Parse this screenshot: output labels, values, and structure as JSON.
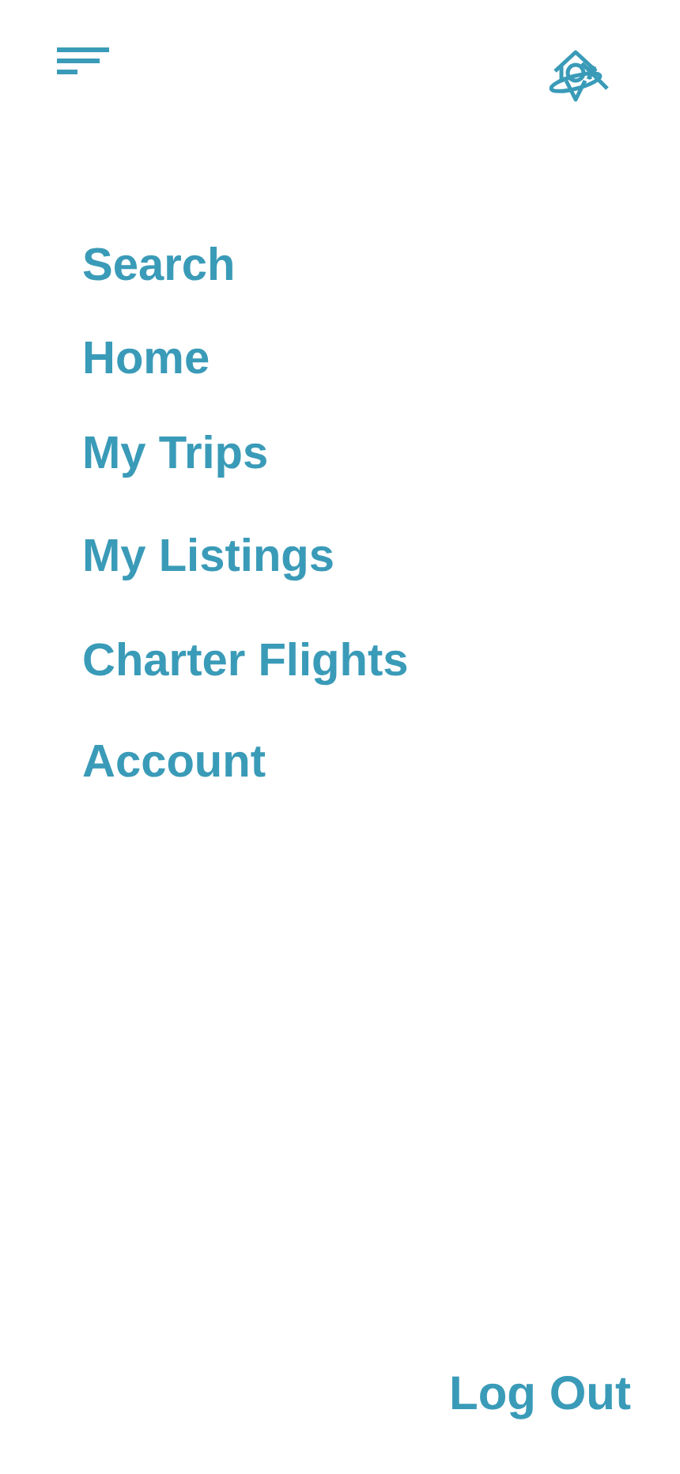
{
  "menu": [
    {
      "label": "Search"
    },
    {
      "label": "Home"
    },
    {
      "label": "My Trips"
    },
    {
      "label": "My Listings"
    },
    {
      "label": "Charter Flights"
    },
    {
      "label": "Account"
    }
  ],
  "logout": "Log Out"
}
